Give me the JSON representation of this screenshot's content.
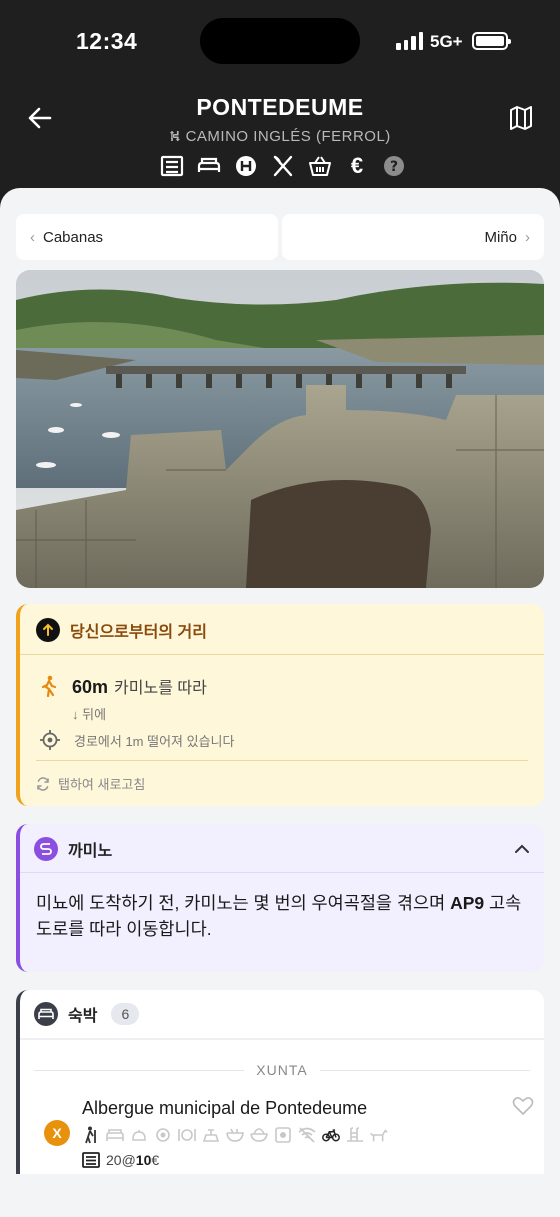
{
  "status": {
    "time": "12:34",
    "network": "5G+"
  },
  "header": {
    "title": "PONTEDEUME",
    "route": "CAMINO INGLÉS (FERROL)",
    "service_icons": [
      "albergue-icon",
      "bed-icon",
      "hotel-icon",
      "restaurant-icon",
      "shop-icon",
      "euro-icon",
      "help-icon"
    ]
  },
  "nav": {
    "prev": "Cabanas",
    "next": "Miño"
  },
  "distance": {
    "title": "당신으로부터의 거리",
    "value": "60m",
    "along": "카미노를 따라",
    "direction": "뒤에",
    "off_route": "경로에서 1m 떨어져 있습니다",
    "refresh": "탭하여 새로고침"
  },
  "camino": {
    "title": "까미노",
    "text_before": "미뇨에 도착하기 전, 카미노는 몇 번의 우여곡절을 겪으며 ",
    "text_bold": "AP9",
    "text_after": " 고속도로를 따라 이동합니다."
  },
  "lodging": {
    "title": "숙박",
    "count": "6",
    "group": "XUNTA",
    "items": [
      {
        "badge": "X",
        "name": "Albergue municipal de Pontedeume",
        "beds": "20",
        "at": "@",
        "price": "10",
        "currency": "€"
      }
    ]
  },
  "colors": {
    "accent_orange": "#f0a21a",
    "accent_purple": "#8a4fe0",
    "badge_orange": "#e8910c"
  }
}
